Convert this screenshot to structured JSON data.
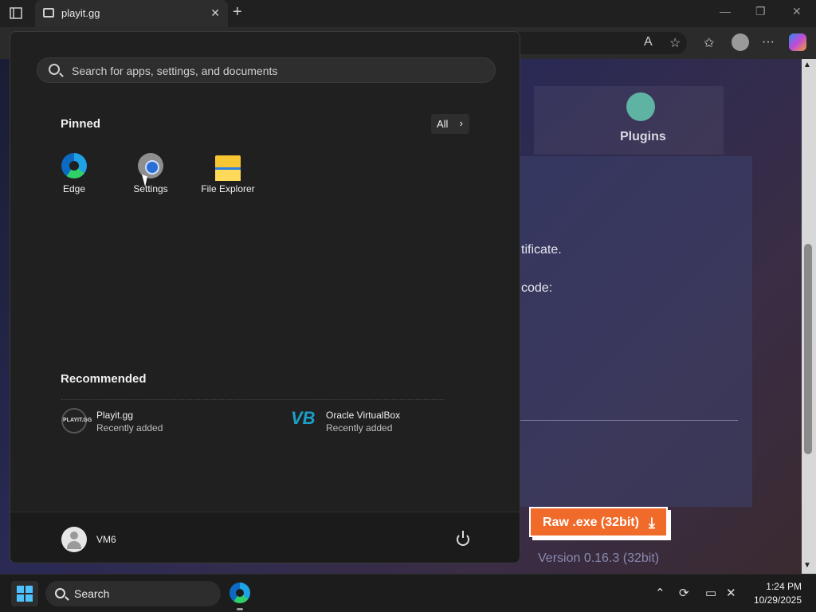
{
  "browser": {
    "tab_title": "playit.gg",
    "tab_close": "✕",
    "new_tab": "+",
    "minimize": "—",
    "restore": "❐",
    "close": "✕",
    "toolbar_icons": [
      "read-aloud-icon",
      "favorite-icon",
      "favorites-icon",
      "profile-icon",
      "more-icon",
      "copilot-icon"
    ]
  },
  "page": {
    "plugins_label": "Plugins",
    "text_certificate": "tificate.",
    "text_code": "code:",
    "download_button": "Raw .exe (32bit)",
    "download_icon": "⤓",
    "version": "Version 0.16.3 (32bit)"
  },
  "start_menu": {
    "search_placeholder": "Search for apps, settings, and documents",
    "pinned_title": "Pinned",
    "all_button": "All",
    "all_chevron": "›",
    "pinned_apps": [
      {
        "label": "Edge",
        "icon": "edge-icon"
      },
      {
        "label": "Settings",
        "icon": "settings-gear-icon"
      },
      {
        "label": "File Explorer",
        "icon": "folder-icon"
      }
    ],
    "recommended_title": "Recommended",
    "recommended": [
      {
        "name": "Playit.gg",
        "sub": "Recently added",
        "icon": "playit-icon",
        "icon_text": "PLAYIT.GG"
      },
      {
        "name": "Oracle VirtualBox",
        "sub": "Recently added",
        "icon": "virtualbox-icon",
        "icon_text": "VB"
      }
    ],
    "user": "VM6"
  },
  "taskbar": {
    "search_label": "Search",
    "time": "1:24 PM",
    "date": "10/29/2025",
    "tray_icons": [
      "chevron-up-icon",
      "sync-icon",
      "display-icon",
      "volume-muted-icon"
    ]
  },
  "colors": {
    "accent": "#4cc2ff",
    "download_button": "#f06a2a",
    "start_bg": "#202020"
  }
}
